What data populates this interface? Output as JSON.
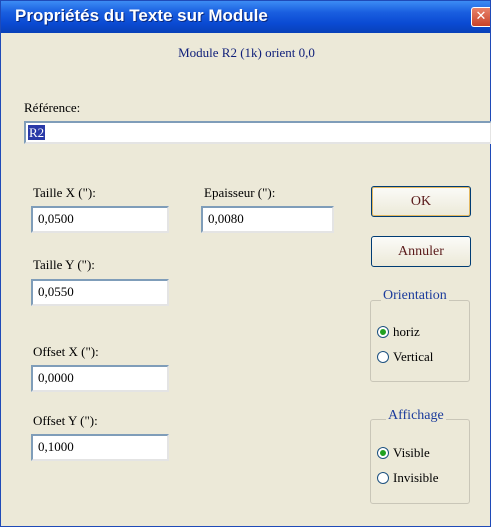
{
  "window": {
    "title": "Propriétés du Texte sur Module",
    "close_glyph": "✕",
    "subtitle": "Module R2 (1k) orient 0,0"
  },
  "reference": {
    "label": "Référence:",
    "value": "R2"
  },
  "fields": {
    "taille_x": {
      "label": "Taille X (\"):",
      "value": "0,0500"
    },
    "epaisseur": {
      "label": "Epaisseur (\"):",
      "value": "0,0080"
    },
    "taille_y": {
      "label": "Taille Y (\"):",
      "value": "0,0550"
    },
    "offset_x": {
      "label": "Offset X (\"):",
      "value": "0,0000"
    },
    "offset_y": {
      "label": "Offset Y (\"):",
      "value": "0,1000"
    }
  },
  "buttons": {
    "ok": "OK",
    "cancel": "Annuler"
  },
  "orientation": {
    "title": "Orientation",
    "options": [
      {
        "label": "horiz",
        "checked": true
      },
      {
        "label": "Vertical",
        "checked": false
      }
    ]
  },
  "affichage": {
    "title": "Affichage",
    "options": [
      {
        "label": "Visible",
        "checked": true
      },
      {
        "label": "Invisible",
        "checked": false
      }
    ]
  },
  "colors": {
    "titlebar": "#0a4ad3",
    "dialog_bg": "#ece9d8",
    "group_title": "#1c3c9c",
    "selection": "#2a3aa8",
    "radio_dot": "#21a121"
  }
}
